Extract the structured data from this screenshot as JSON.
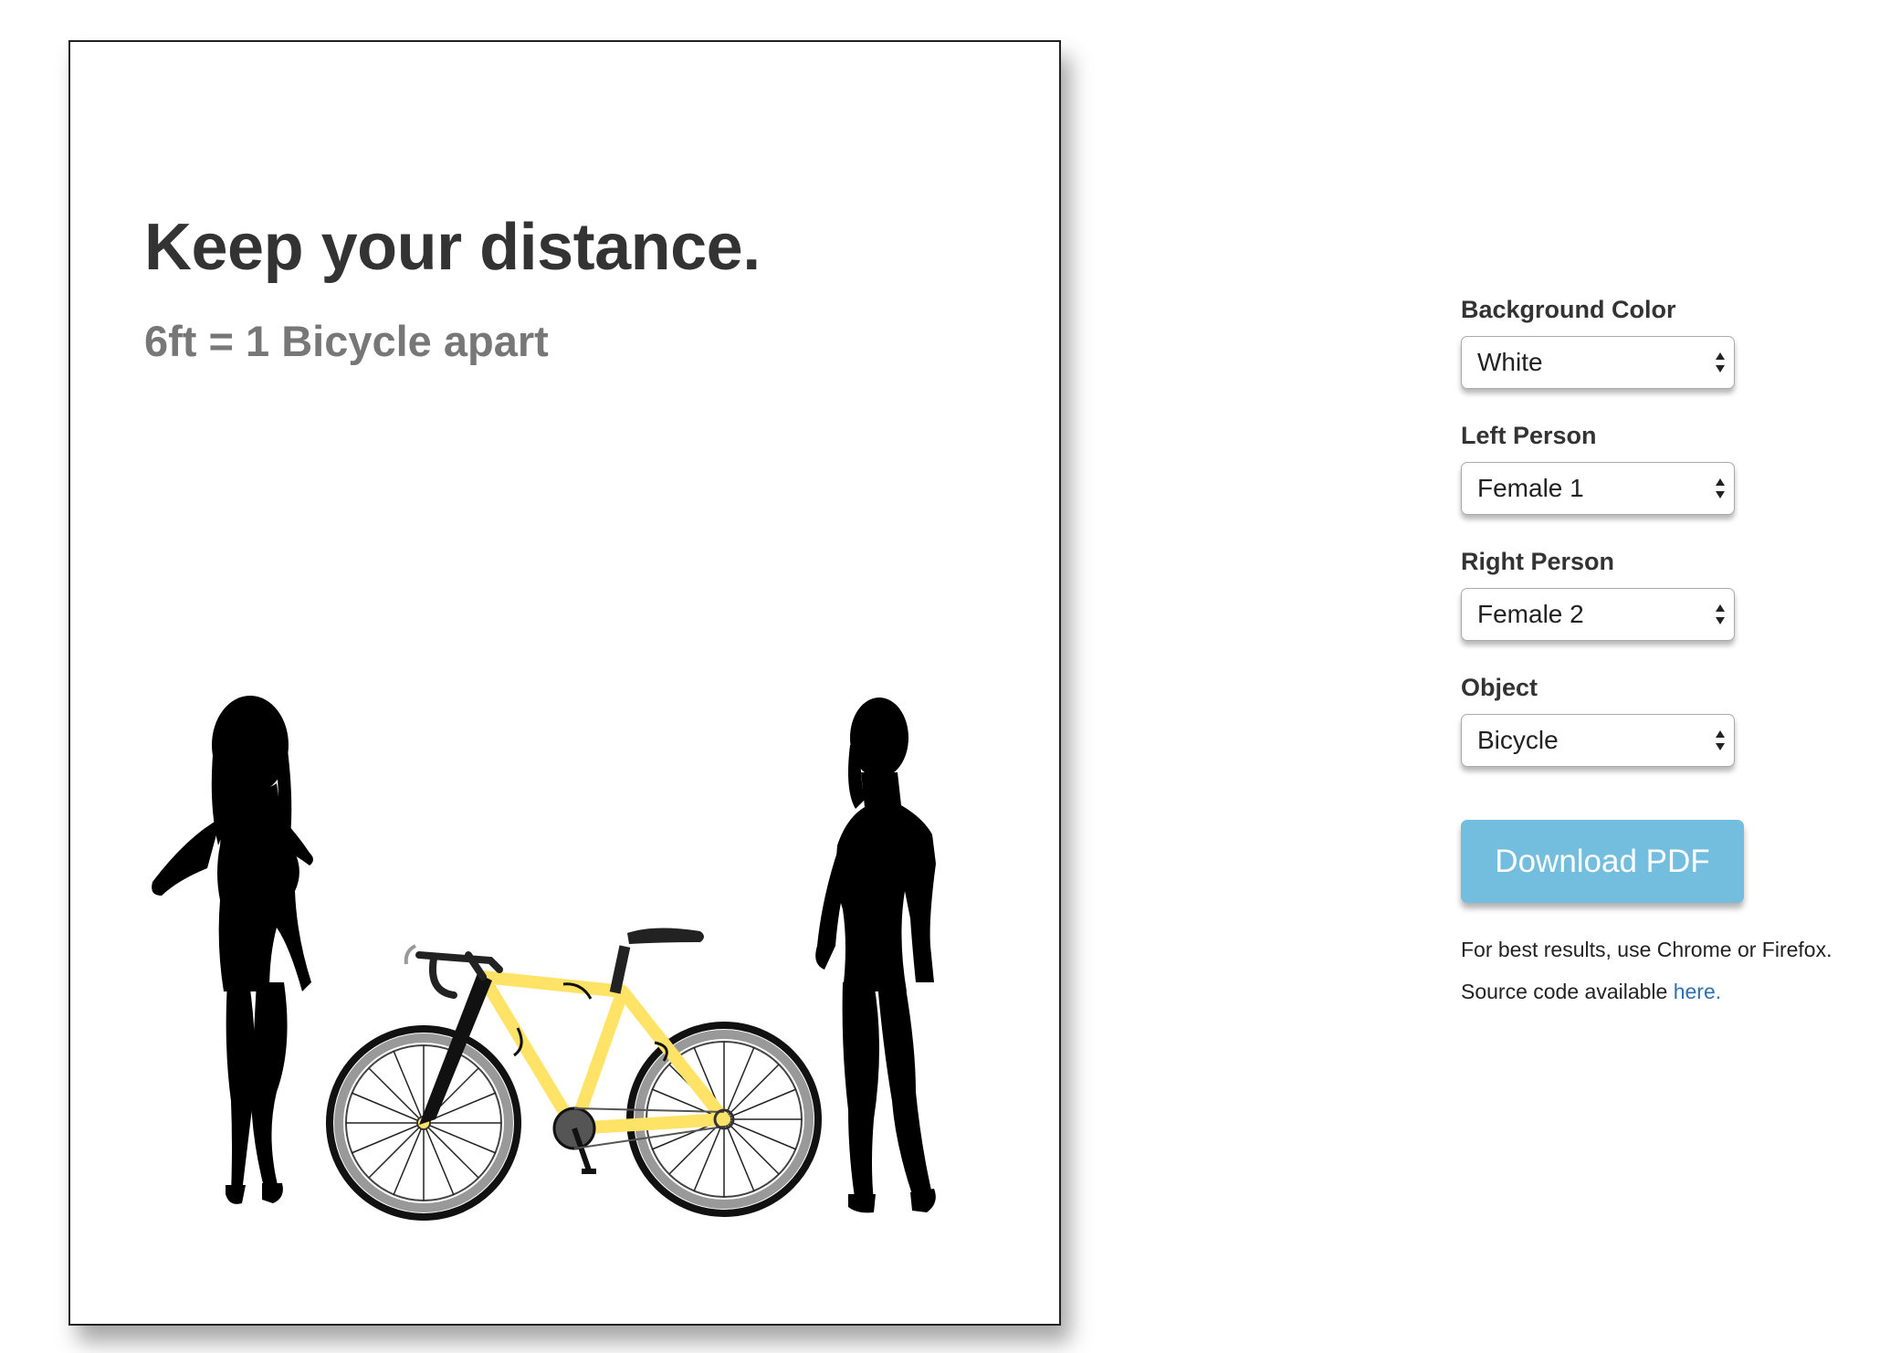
{
  "poster": {
    "title": "Keep your distance.",
    "subtitle": "6ft = 1 Bicycle apart",
    "background": "#ffffff",
    "frame_color": "#ffe367"
  },
  "controls": {
    "background_color": {
      "label": "Background Color",
      "value": "White"
    },
    "left_person": {
      "label": "Left Person",
      "value": "Female 1"
    },
    "right_person": {
      "label": "Right Person",
      "value": "Female 2"
    },
    "object": {
      "label": "Object",
      "value": "Bicycle"
    },
    "download_label": "Download PDF",
    "button_color": "#73bede"
  },
  "notes": {
    "browsers": "For best results, use Chrome or Firefox.",
    "source_prefix": "Source code available ",
    "source_link": "here."
  },
  "icons": {
    "select_arrow": "select-arrows-icon",
    "left_figure": "female-silhouette-icon",
    "right_figure": "female-silhouette-icon",
    "object": "bicycle-icon"
  }
}
